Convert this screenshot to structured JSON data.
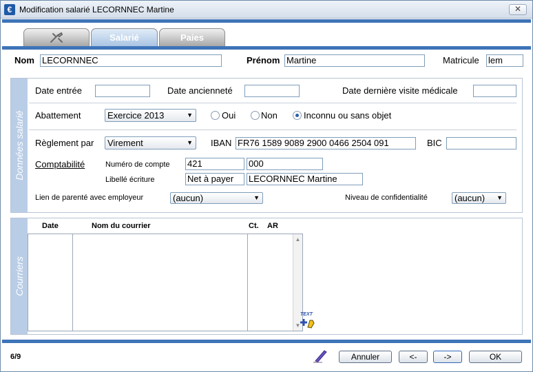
{
  "window": {
    "title": "Modification salarié LECORNNEC Martine",
    "close_glyph": "✕",
    "app_glyph": "€"
  },
  "tabs": [
    {
      "label": ""
    },
    {
      "label": "Salarié"
    },
    {
      "label": "Paies"
    }
  ],
  "header": {
    "nom_label": "Nom",
    "nom_value": "LECORNNEC",
    "prenom_label": "Prénom",
    "prenom_value": "Martine",
    "matricule_label": "Matricule",
    "matricule_value": "lem"
  },
  "donnees": {
    "section_title": "Données salarié",
    "date_entree_label": "Date entrée",
    "date_entree_value": "",
    "date_anciennete_label": "Date ancienneté",
    "date_anciennete_value": "",
    "date_visite_label": "Date dernière visite médicale",
    "date_visite_value": "",
    "abattement_label": "Abattement",
    "abattement_value": "Exercice 2013",
    "radio_oui": "Oui",
    "radio_non": "Non",
    "radio_inconnu": "Inconnu ou sans objet",
    "reglement_label": "Règlement par",
    "reglement_value": "Virement",
    "iban_label": "IBAN",
    "iban_value": "FR76 1589 9089 2900 0466 2504 091",
    "bic_label": "BIC",
    "bic_value": "",
    "comptabilite_link": "Comptabilité",
    "numero_compte_label": "Numéro de compte",
    "numero_compte_value1": "421",
    "numero_compte_value2": "000",
    "libelle_label": "Libellé écriture",
    "libelle_value1": "Net à payer",
    "libelle_value2": "LECORNNEC Martine",
    "lien_parente_label": "Lien de parenté avec employeur",
    "lien_parente_value": "(aucun)",
    "confidentialite_label": "Niveau de confidentialité",
    "confidentialite_value": "(aucun)"
  },
  "courriers": {
    "section_title": "Courriers",
    "columns": [
      "Date",
      "Nom du courrier",
      "Ct.",
      "AR"
    ],
    "text_icon_label": "TEXT"
  },
  "footer": {
    "page": "6/9",
    "annuler": "Annuler",
    "prev": "<-",
    "next": "->",
    "ok": "OK"
  }
}
